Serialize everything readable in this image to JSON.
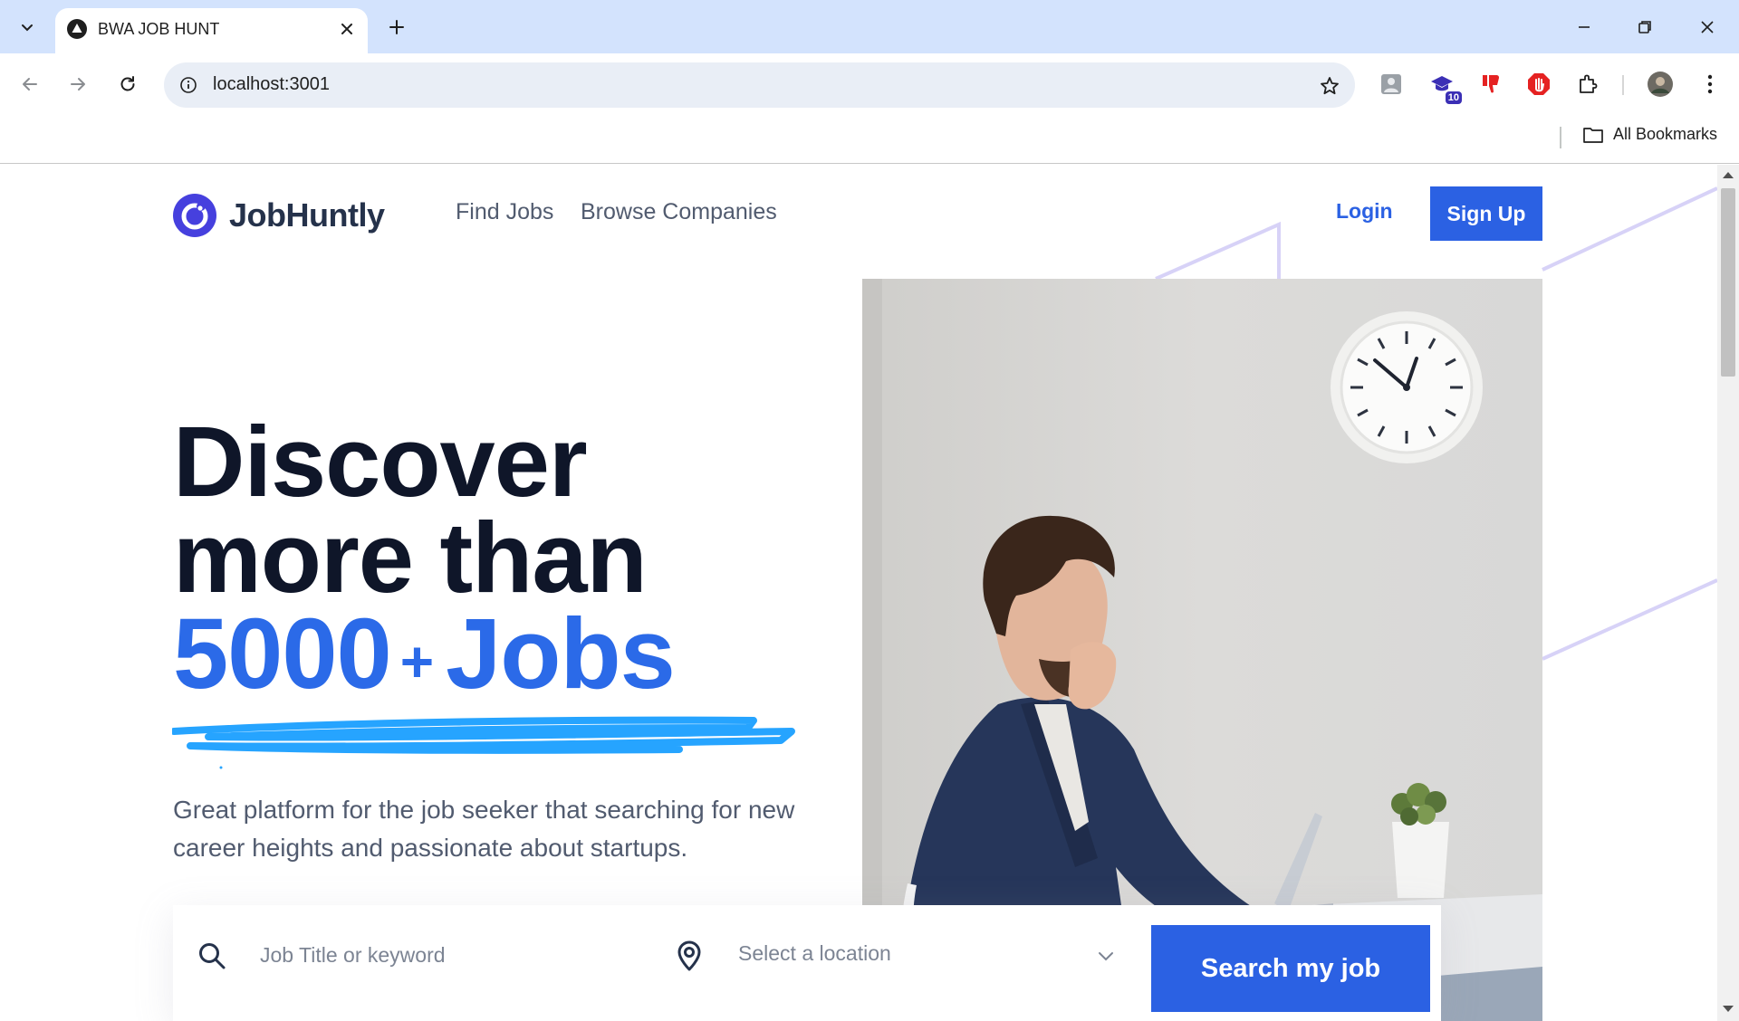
{
  "browser": {
    "tab_title": "BWA JOB HUNT",
    "url": "localhost:3001",
    "bookmarks_label": "All Bookmarks",
    "extension_badge": "10"
  },
  "header": {
    "logo_text": "JobHuntly",
    "nav": [
      "Find Jobs",
      "Browse Companies"
    ],
    "login_label": "Login",
    "signup_label": "Sign Up"
  },
  "hero": {
    "headline_line1": "Discover",
    "headline_line2": "more than",
    "headline_accent_number": "5000",
    "headline_accent_plus": "+",
    "headline_accent_word": "Jobs",
    "subtext": "Great platform for the job seeker that searching for new career heights and passionate about startups."
  },
  "search": {
    "keyword_placeholder": "Job Title or keyword",
    "location_placeholder": "Select a location",
    "button_label": "Search my job"
  },
  "colors": {
    "primary": "#2b61e3",
    "accent_text": "#2b6ae8",
    "underline": "#26a4ff",
    "heading": "#0f1629",
    "body_text": "#515b6f",
    "tab_bar": "#d3e3fd"
  }
}
